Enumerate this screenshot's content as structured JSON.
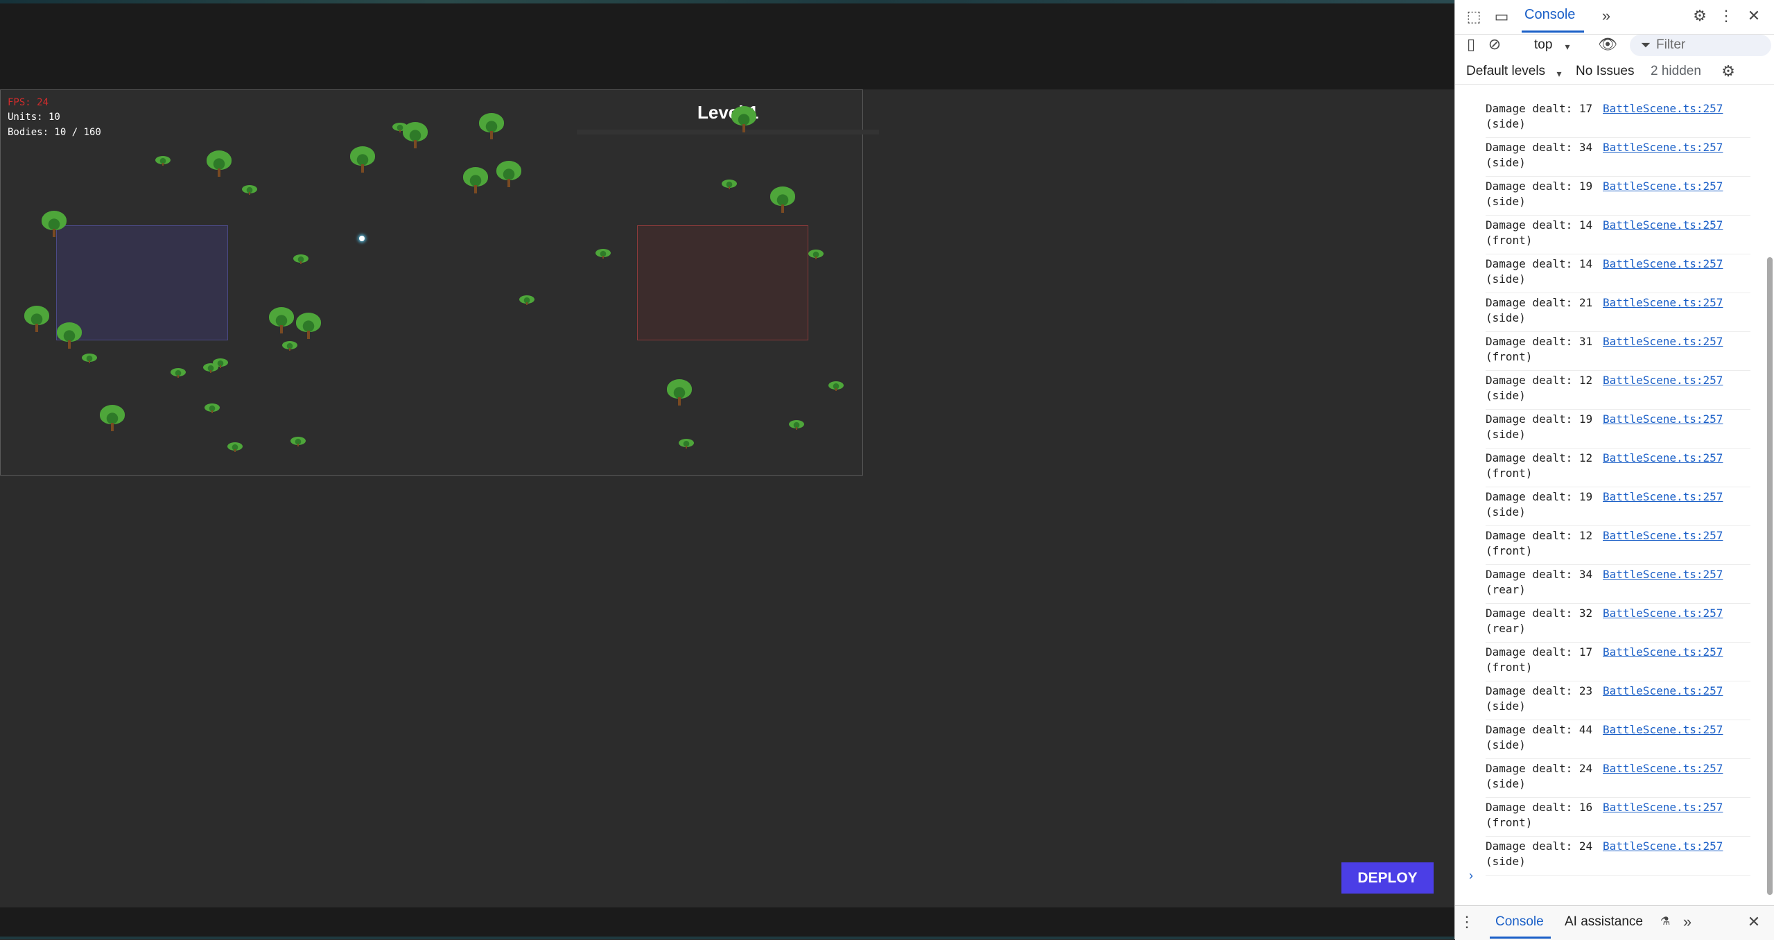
{
  "game": {
    "hud": {
      "fps": "FPS: 24",
      "units": "Units: 10",
      "bodies": "Bodies: 10 / 160"
    },
    "level_title": "Level 1",
    "deploy_label": "DEPLOY"
  },
  "devtools": {
    "tabs": {
      "active": "Console",
      "more": "»"
    },
    "toolbar": {
      "context": "top",
      "filter_placeholder": "Filter"
    },
    "toolbar2": {
      "levels": "Default levels",
      "issues": "No Issues",
      "hidden": "2 hidden"
    },
    "console_logs": [
      {
        "message": "Damage dealt: 17\n(side)",
        "source": "BattleScene.ts:257"
      },
      {
        "message": "Damage dealt: 34\n(side)",
        "source": "BattleScene.ts:257"
      },
      {
        "message": "Damage dealt: 19\n(side)",
        "source": "BattleScene.ts:257"
      },
      {
        "message": "Damage dealt: 14\n(front)",
        "source": "BattleScene.ts:257"
      },
      {
        "message": "Damage dealt: 14\n(side)",
        "source": "BattleScene.ts:257"
      },
      {
        "message": "Damage dealt: 21\n(side)",
        "source": "BattleScene.ts:257"
      },
      {
        "message": "Damage dealt: 31\n(front)",
        "source": "BattleScene.ts:257"
      },
      {
        "message": "Damage dealt: 12\n(side)",
        "source": "BattleScene.ts:257"
      },
      {
        "message": "Damage dealt: 19\n(side)",
        "source": "BattleScene.ts:257"
      },
      {
        "message": "Damage dealt: 12\n(front)",
        "source": "BattleScene.ts:257"
      },
      {
        "message": "Damage dealt: 19\n(side)",
        "source": "BattleScene.ts:257"
      },
      {
        "message": "Damage dealt: 12\n(front)",
        "source": "BattleScene.ts:257"
      },
      {
        "message": "Damage dealt: 34\n(rear)",
        "source": "BattleScene.ts:257"
      },
      {
        "message": "Damage dealt: 32\n(rear)",
        "source": "BattleScene.ts:257"
      },
      {
        "message": "Damage dealt: 17\n(front)",
        "source": "BattleScene.ts:257"
      },
      {
        "message": "Damage dealt: 23\n(side)",
        "source": "BattleScene.ts:257"
      },
      {
        "message": "Damage dealt: 44\n(side)",
        "source": "BattleScene.ts:257"
      },
      {
        "message": "Damage dealt: 24\n(side)",
        "source": "BattleScene.ts:257"
      },
      {
        "message": "Damage dealt: 16\n(front)",
        "source": "BattleScene.ts:257"
      },
      {
        "message": "Damage dealt: 24\n(side)",
        "source": "BattleScene.ts:257"
      }
    ],
    "drawer": {
      "console": "Console",
      "ai": "AI assistance"
    }
  }
}
